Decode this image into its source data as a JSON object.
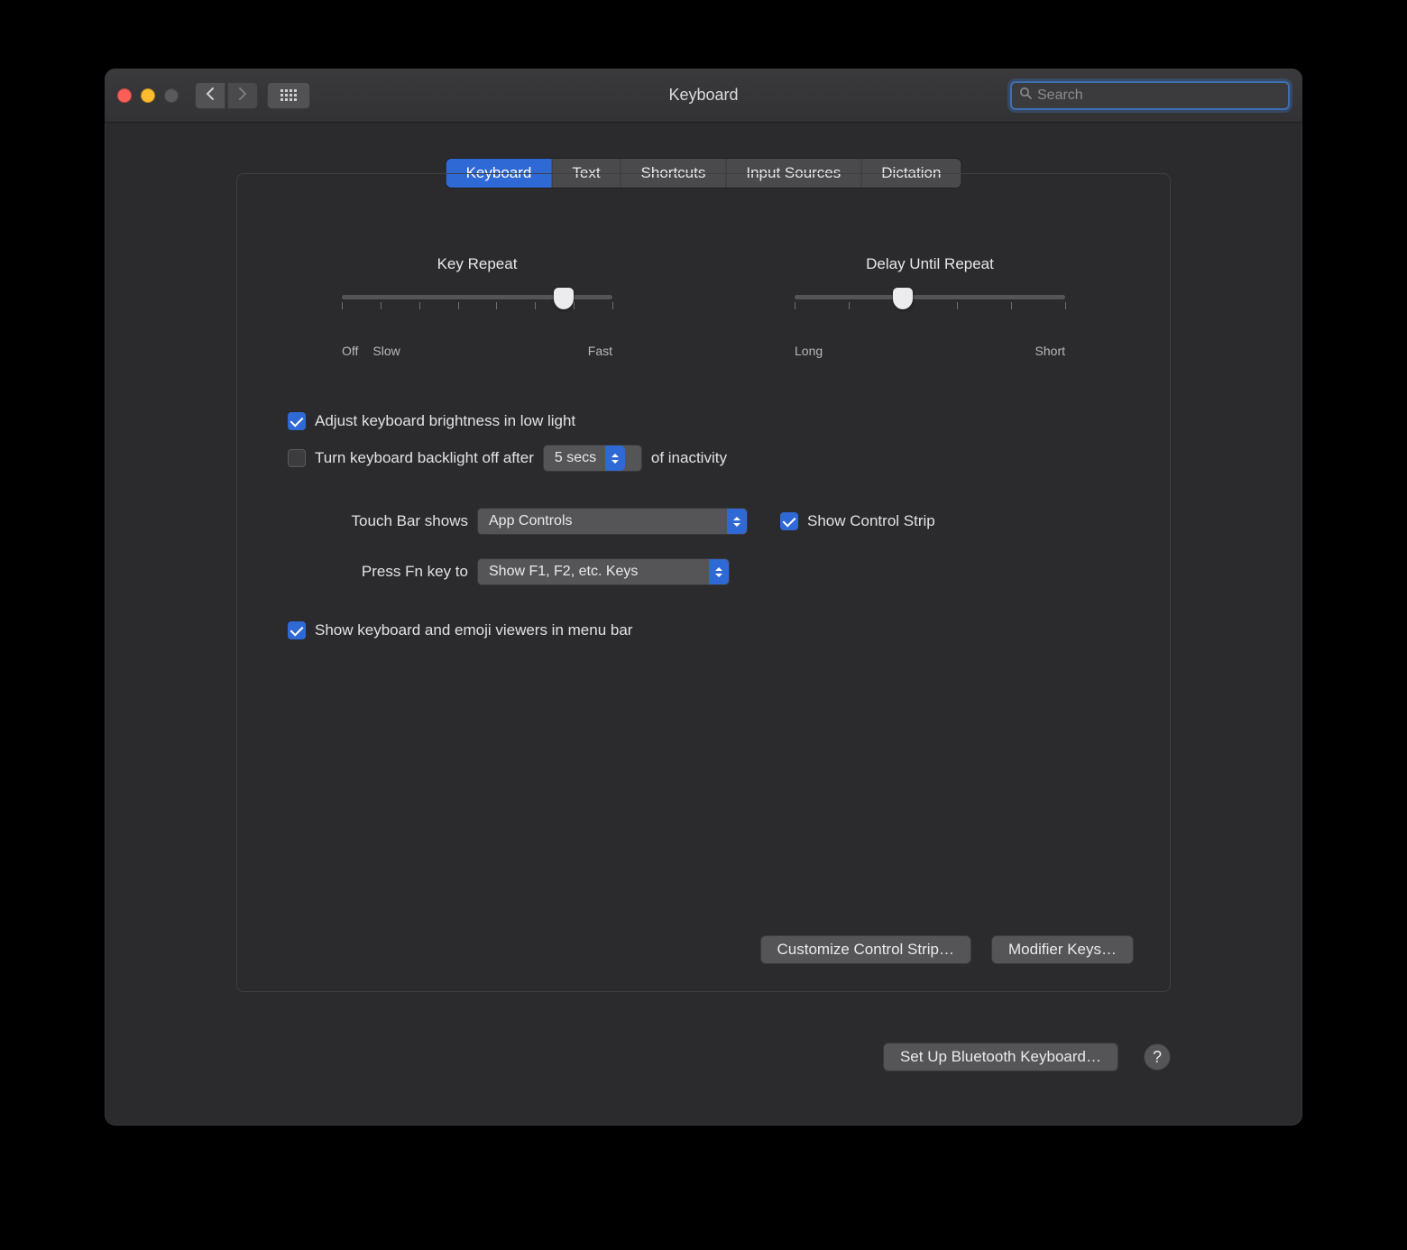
{
  "window": {
    "title": "Keyboard"
  },
  "search": {
    "placeholder": "Search"
  },
  "tabs": [
    {
      "label": "Keyboard",
      "active": true
    },
    {
      "label": "Text",
      "active": false
    },
    {
      "label": "Shortcuts",
      "active": false
    },
    {
      "label": "Input Sources",
      "active": false
    },
    {
      "label": "Dictation",
      "active": false
    }
  ],
  "sliders": {
    "key_repeat": {
      "title": "Key Repeat",
      "left_label_1": "Off",
      "left_label_2": "Slow",
      "right_label": "Fast",
      "ticks": 8,
      "value_index": 7
    },
    "delay": {
      "title": "Delay Until Repeat",
      "left_label": "Long",
      "right_label": "Short",
      "ticks": 6,
      "value_index": 2
    }
  },
  "options": {
    "brightness_label": "Adjust keyboard brightness in low light",
    "brightness_checked": true,
    "backlight_label_pre": "Turn keyboard backlight off after",
    "backlight_select": "5 secs",
    "backlight_label_post": "of inactivity",
    "backlight_checked": false,
    "touchbar_label": "Touch Bar shows",
    "touchbar_select": "App Controls",
    "show_control_strip_label": "Show Control Strip",
    "show_control_strip_checked": true,
    "fn_label": "Press Fn key to",
    "fn_select": "Show F1, F2, etc. Keys",
    "viewers_label": "Show keyboard and emoji viewers in menu bar",
    "viewers_checked": true
  },
  "buttons": {
    "customize": "Customize Control Strip…",
    "modifier": "Modifier Keys…",
    "bluetooth": "Set Up Bluetooth Keyboard…"
  }
}
